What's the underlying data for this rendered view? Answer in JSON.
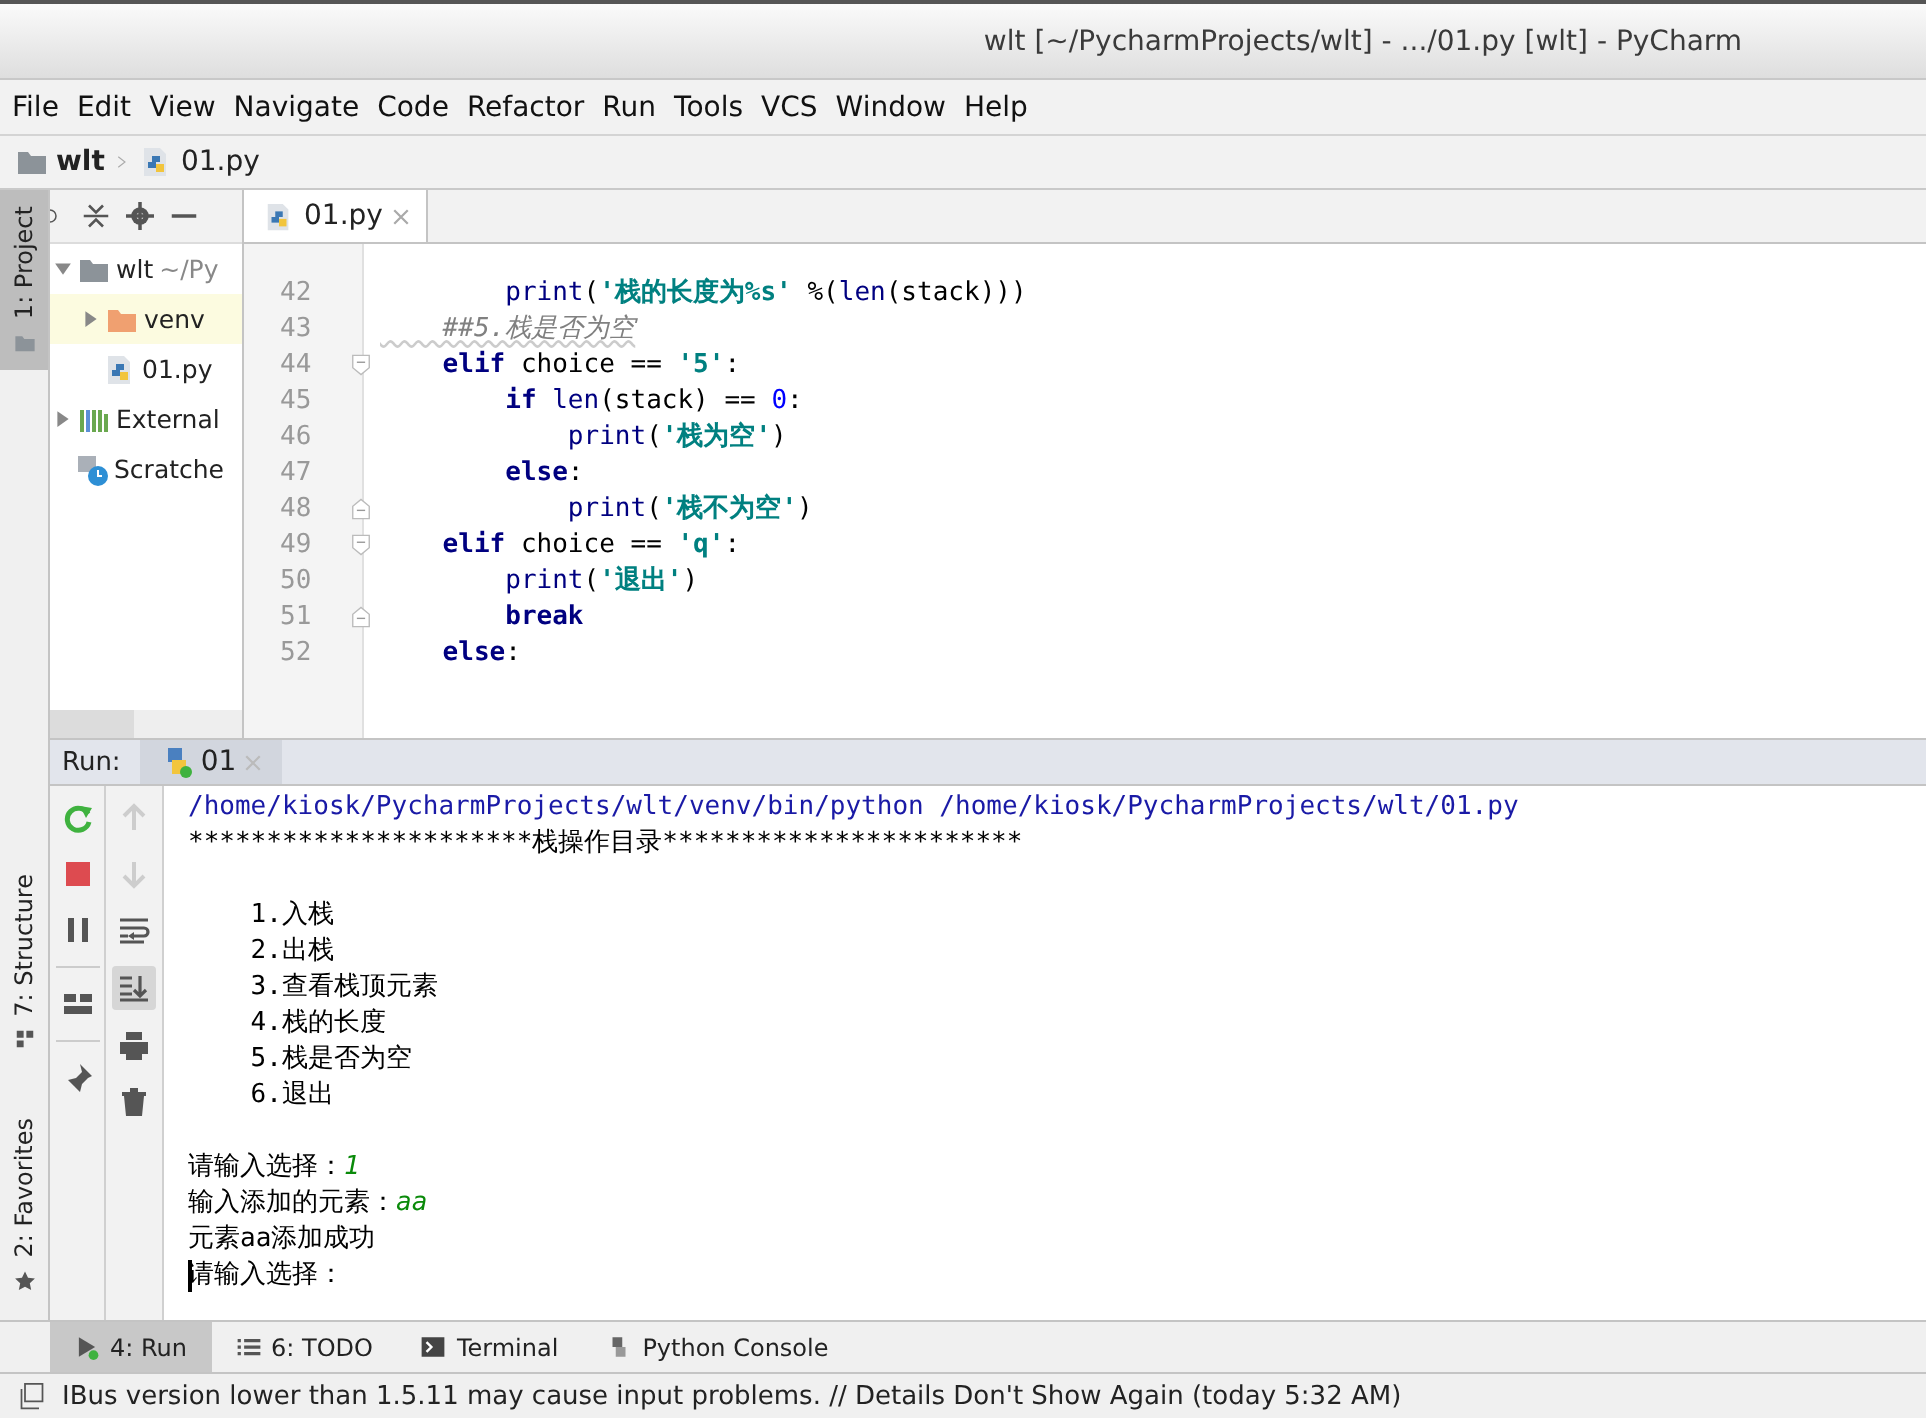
{
  "window": {
    "title": "wlt [~/PycharmProjects/wlt] - .../01.py [wlt] - PyCharm"
  },
  "menu": [
    "File",
    "Edit",
    "View",
    "Navigate",
    "Code",
    "Refactor",
    "Run",
    "Tools",
    "VCS",
    "Window",
    "Help"
  ],
  "breadcrumb": [
    {
      "label": "wlt",
      "kind": "folder"
    },
    {
      "label": "01.py",
      "kind": "python"
    }
  ],
  "left_stripe": [
    {
      "label": "1: Project",
      "kind": "folder",
      "selected": true
    },
    {
      "label": "7: Structure",
      "kind": "structure",
      "selected": false
    },
    {
      "label": "2: Favorites",
      "kind": "star",
      "selected": false
    }
  ],
  "project_tree": [
    {
      "label": "wlt",
      "hint": "~/Py",
      "kind": "folder",
      "expanded": true,
      "selected": false,
      "children": [
        {
          "label": "venv",
          "kind": "venv",
          "expanded": false,
          "selected": true
        },
        {
          "label": "01.py",
          "kind": "python",
          "selected": false
        }
      ]
    },
    {
      "label": "External",
      "kind": "library",
      "expanded": false,
      "selected": false
    },
    {
      "label": "Scratche",
      "kind": "scratch",
      "selected": false
    }
  ],
  "editor": {
    "tabs": [
      {
        "label": "01.py",
        "selected": true
      }
    ],
    "lines": [
      {
        "number": "42",
        "fold_start": false,
        "fold_end": false,
        "tokens": [
          {
            "t": "        print",
            "kind": "builtin"
          },
          {
            "t": "(",
            "kind": "plain"
          },
          {
            "t": "'栈的长度为%s'",
            "kind": "string"
          },
          {
            "t": " %(",
            "kind": "plain"
          },
          {
            "t": "len",
            "kind": "builtin"
          },
          {
            "t": "(stack)))",
            "kind": "plain"
          }
        ]
      },
      {
        "number": "43",
        "fold_start": false,
        "fold_end": false,
        "tokens": [
          {
            "t": "    ##5.栈是否为空",
            "kind": "comment"
          }
        ]
      },
      {
        "number": "44",
        "fold_start": true,
        "fold_end": false,
        "tokens": [
          {
            "t": "    elif",
            "kind": "keyword"
          },
          {
            "t": " choice == ",
            "kind": "plain"
          },
          {
            "t": "'5'",
            "kind": "string"
          },
          {
            "t": ":",
            "kind": "plain"
          }
        ]
      },
      {
        "number": "45",
        "fold_start": false,
        "fold_end": false,
        "tokens": [
          {
            "t": "        if",
            "kind": "keyword"
          },
          {
            "t": " len",
            "kind": "builtin"
          },
          {
            "t": "(stack) == ",
            "kind": "plain"
          },
          {
            "t": "0",
            "kind": "number"
          },
          {
            "t": ":",
            "kind": "plain"
          }
        ]
      },
      {
        "number": "46",
        "fold_start": false,
        "fold_end": false,
        "tokens": [
          {
            "t": "            print",
            "kind": "builtin"
          },
          {
            "t": "(",
            "kind": "plain"
          },
          {
            "t": "'栈为空'",
            "kind": "string"
          },
          {
            "t": ")",
            "kind": "plain"
          }
        ]
      },
      {
        "number": "47",
        "fold_start": false,
        "fold_end": false,
        "tokens": [
          {
            "t": "        else",
            "kind": "keyword"
          },
          {
            "t": ":",
            "kind": "plain"
          }
        ]
      },
      {
        "number": "48",
        "fold_start": false,
        "fold_end": true,
        "tokens": [
          {
            "t": "            print",
            "kind": "builtin"
          },
          {
            "t": "(",
            "kind": "plain"
          },
          {
            "t": "'栈不为空'",
            "kind": "string"
          },
          {
            "t": ")",
            "kind": "plain"
          }
        ]
      },
      {
        "number": "49",
        "fold_start": true,
        "fold_end": false,
        "tokens": [
          {
            "t": "    elif",
            "kind": "keyword"
          },
          {
            "t": " choice == ",
            "kind": "plain"
          },
          {
            "t": "'q'",
            "kind": "string"
          },
          {
            "t": ":",
            "kind": "plain"
          }
        ]
      },
      {
        "number": "50",
        "fold_start": false,
        "fold_end": false,
        "tokens": [
          {
            "t": "        print",
            "kind": "builtin"
          },
          {
            "t": "(",
            "kind": "plain"
          },
          {
            "t": "'退出'",
            "kind": "string"
          },
          {
            "t": ")",
            "kind": "plain"
          }
        ]
      },
      {
        "number": "51",
        "fold_start": false,
        "fold_end": true,
        "tokens": [
          {
            "t": "        break",
            "kind": "keyword"
          }
        ]
      },
      {
        "number": "52",
        "fold_start": false,
        "fold_end": false,
        "tokens": [
          {
            "t": "    else",
            "kind": "keyword"
          },
          {
            "t": ":",
            "kind": "plain"
          }
        ]
      }
    ]
  },
  "run": {
    "label": "Run:",
    "tabs": [
      {
        "label": "01",
        "selected": true
      }
    ],
    "tools": [
      {
        "kind": "rerun"
      },
      {
        "kind": "stop"
      },
      {
        "kind": "pause"
      },
      {
        "kind": "layout"
      },
      {
        "kind": "pin"
      }
    ],
    "tools_2": [
      {
        "kind": "up",
        "disabled": true,
        "on": false
      },
      {
        "kind": "down",
        "disabled": true,
        "on": false
      },
      {
        "kind": "wrap",
        "disabled": false,
        "on": false
      },
      {
        "kind": "scroll-end",
        "disabled": false,
        "on": true
      },
      {
        "kind": "print",
        "disabled": false,
        "on": false
      },
      {
        "kind": "trash",
        "disabled": false,
        "on": false
      }
    ],
    "console": [
      {
        "kind": "command",
        "text": "/home/kiosk/PycharmProjects/wlt/venv/bin/python /home/kiosk/PycharmProjects/wlt/01.py"
      },
      {
        "kind": "output",
        "text": "**********************栈操作目录***********************"
      },
      {
        "kind": "blank"
      },
      {
        "kind": "output",
        "text": "    1.入栈"
      },
      {
        "kind": "output",
        "text": "    2.出栈"
      },
      {
        "kind": "output",
        "text": "    3.查看栈顶元素"
      },
      {
        "kind": "output",
        "text": "    4.栈的长度"
      },
      {
        "kind": "output",
        "text": "    5.栈是否为空"
      },
      {
        "kind": "output",
        "text": "    6.退出"
      },
      {
        "kind": "blank"
      },
      {
        "kind": "prompt",
        "text": "请输入选择：",
        "input": "1",
        "cursor": false
      },
      {
        "kind": "prompt",
        "text": "输入添加的元素：",
        "input": "aa",
        "cursor": false
      },
      {
        "kind": "output",
        "text": "元素aa添加成功"
      },
      {
        "kind": "prompt",
        "text": "请输入选择：",
        "cursor": true
      }
    ]
  },
  "bottom_tabs": [
    {
      "label": "4: Run",
      "kind": "run",
      "selected": true
    },
    {
      "label": "6: TODO",
      "kind": "todo",
      "selected": false
    },
    {
      "label": "Terminal",
      "kind": "terminal",
      "selected": false
    },
    {
      "label": "Python Console",
      "kind": "python-console",
      "selected": false
    }
  ],
  "status_bar": {
    "message": "IBus version lower than 1.5.11 may cause input problems. // Details Don't Show Again (today 5:32 AM)"
  }
}
